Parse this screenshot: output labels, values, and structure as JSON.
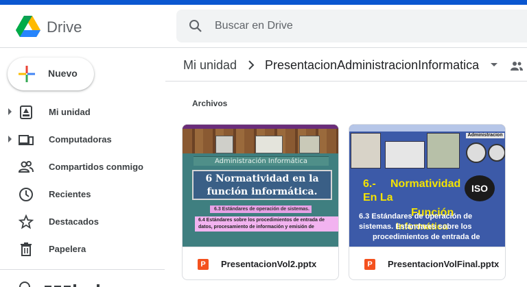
{
  "app": {
    "name": "Drive"
  },
  "search": {
    "placeholder": "Buscar en Drive"
  },
  "sidebar": {
    "new_label": "Nuevo",
    "items": [
      {
        "label": "Mi unidad",
        "icon": "my-drive-icon"
      },
      {
        "label": "Computadoras",
        "icon": "computer-icon"
      },
      {
        "label": "Compartidos conmigo",
        "icon": "people-icon"
      },
      {
        "label": "Recientes",
        "icon": "clock-icon"
      },
      {
        "label": "Destacados",
        "icon": "star-icon"
      },
      {
        "label": "Papelera",
        "icon": "trash-icon"
      }
    ]
  },
  "breadcrumb": {
    "root": "Mi unidad",
    "current": "PresentacionAdministracionInformatica"
  },
  "section": {
    "files_label": "Archivos"
  },
  "files": [
    {
      "name": "PresentacionVol2.pptx",
      "type_badge": "P",
      "thumb": {
        "subtitle": "Administración Informática",
        "title": "6 Normatividad en la función informática.",
        "line1": "6.3 Estándares de operación de sistemas.",
        "line2": "6.4 Estándares sobre los procedimientos de entrada de datos, procesamiento de información y emisión de"
      }
    },
    {
      "name": "PresentacionVolFinal.pptx",
      "type_badge": "P",
      "thumb": {
        "corner": "Administracion",
        "y1": "6.-",
        "y2": "Normatividad",
        "y3": "En La",
        "y4": "Función",
        "y5": "Informática",
        "w1": "6.3 Estándares de operación de",
        "w2": "sistemas. Estándares sobre los",
        "w3": "procedimientos de entrada de",
        "iso": "ISO"
      }
    }
  ],
  "colors": {
    "accent": "#0b57d0",
    "ppt": "#f4511e",
    "search_bg": "#f1f3f4"
  }
}
